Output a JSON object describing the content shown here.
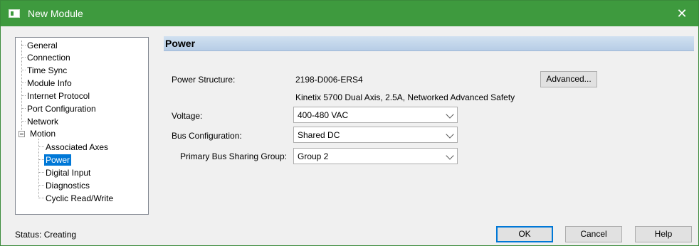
{
  "window": {
    "title": "New Module",
    "close_glyph": "✕"
  },
  "tree": {
    "items": [
      {
        "label": "General"
      },
      {
        "label": "Connection"
      },
      {
        "label": "Time Sync"
      },
      {
        "label": "Module Info"
      },
      {
        "label": "Internet Protocol"
      },
      {
        "label": "Port Configuration"
      },
      {
        "label": "Network"
      },
      {
        "label": "Motion"
      },
      {
        "label": "Associated Axes"
      },
      {
        "label": "Power"
      },
      {
        "label": "Digital Input"
      },
      {
        "label": "Diagnostics"
      },
      {
        "label": "Cyclic Read/Write"
      }
    ],
    "selected": "Power"
  },
  "section": {
    "title": "Power"
  },
  "fields": {
    "power_structure": {
      "label": "Power Structure:",
      "value": "2198-D006-ERS4",
      "description": "Kinetix 5700 Dual Axis, 2.5A, Networked Advanced Safety"
    },
    "voltage": {
      "label": "Voltage:",
      "value": "400-480 VAC"
    },
    "bus_configuration": {
      "label": "Bus Configuration:",
      "value": "Shared DC"
    },
    "primary_bus_sharing_group": {
      "label": "Primary Bus Sharing Group:",
      "value": "Group 2"
    }
  },
  "buttons": {
    "advanced": "Advanced...",
    "ok": "OK",
    "cancel": "Cancel",
    "help": "Help"
  },
  "status": {
    "text": "Status:  Creating"
  },
  "colors": {
    "titlebar": "#3e9a3e",
    "selection": "#0078d7"
  }
}
